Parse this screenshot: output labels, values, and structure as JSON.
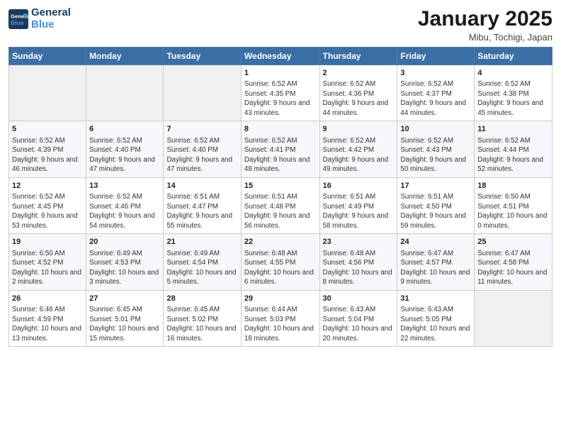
{
  "logo": {
    "line1": "General",
    "line2": "Blue"
  },
  "title": "January 2025",
  "subtitle": "Mibu, Tochigi, Japan",
  "days_of_week": [
    "Sunday",
    "Monday",
    "Tuesday",
    "Wednesday",
    "Thursday",
    "Friday",
    "Saturday"
  ],
  "weeks": [
    [
      {
        "day": "",
        "info": ""
      },
      {
        "day": "",
        "info": ""
      },
      {
        "day": "",
        "info": ""
      },
      {
        "day": "1",
        "info": "Sunrise: 6:52 AM\nSunset: 4:35 PM\nDaylight: 9 hours and 43 minutes."
      },
      {
        "day": "2",
        "info": "Sunrise: 6:52 AM\nSunset: 4:36 PM\nDaylight: 9 hours and 44 minutes."
      },
      {
        "day": "3",
        "info": "Sunrise: 6:52 AM\nSunset: 4:37 PM\nDaylight: 9 hours and 44 minutes."
      },
      {
        "day": "4",
        "info": "Sunrise: 6:52 AM\nSunset: 4:38 PM\nDaylight: 9 hours and 45 minutes."
      }
    ],
    [
      {
        "day": "5",
        "info": "Sunrise: 6:52 AM\nSunset: 4:39 PM\nDaylight: 9 hours and 46 minutes."
      },
      {
        "day": "6",
        "info": "Sunrise: 6:52 AM\nSunset: 4:40 PM\nDaylight: 9 hours and 47 minutes."
      },
      {
        "day": "7",
        "info": "Sunrise: 6:52 AM\nSunset: 4:40 PM\nDaylight: 9 hours and 47 minutes."
      },
      {
        "day": "8",
        "info": "Sunrise: 6:52 AM\nSunset: 4:41 PM\nDaylight: 9 hours and 48 minutes."
      },
      {
        "day": "9",
        "info": "Sunrise: 6:52 AM\nSunset: 4:42 PM\nDaylight: 9 hours and 49 minutes."
      },
      {
        "day": "10",
        "info": "Sunrise: 6:52 AM\nSunset: 4:43 PM\nDaylight: 9 hours and 50 minutes."
      },
      {
        "day": "11",
        "info": "Sunrise: 6:52 AM\nSunset: 4:44 PM\nDaylight: 9 hours and 52 minutes."
      }
    ],
    [
      {
        "day": "12",
        "info": "Sunrise: 6:52 AM\nSunset: 4:45 PM\nDaylight: 9 hours and 53 minutes."
      },
      {
        "day": "13",
        "info": "Sunrise: 6:52 AM\nSunset: 4:46 PM\nDaylight: 9 hours and 54 minutes."
      },
      {
        "day": "14",
        "info": "Sunrise: 6:51 AM\nSunset: 4:47 PM\nDaylight: 9 hours and 55 minutes."
      },
      {
        "day": "15",
        "info": "Sunrise: 6:51 AM\nSunset: 4:48 PM\nDaylight: 9 hours and 56 minutes."
      },
      {
        "day": "16",
        "info": "Sunrise: 6:51 AM\nSunset: 4:49 PM\nDaylight: 9 hours and 58 minutes."
      },
      {
        "day": "17",
        "info": "Sunrise: 6:51 AM\nSunset: 4:50 PM\nDaylight: 9 hours and 59 minutes."
      },
      {
        "day": "18",
        "info": "Sunrise: 6:50 AM\nSunset: 4:51 PM\nDaylight: 10 hours and 0 minutes."
      }
    ],
    [
      {
        "day": "19",
        "info": "Sunrise: 6:50 AM\nSunset: 4:52 PM\nDaylight: 10 hours and 2 minutes."
      },
      {
        "day": "20",
        "info": "Sunrise: 6:49 AM\nSunset: 4:53 PM\nDaylight: 10 hours and 3 minutes."
      },
      {
        "day": "21",
        "info": "Sunrise: 6:49 AM\nSunset: 4:54 PM\nDaylight: 10 hours and 5 minutes."
      },
      {
        "day": "22",
        "info": "Sunrise: 6:48 AM\nSunset: 4:55 PM\nDaylight: 10 hours and 6 minutes."
      },
      {
        "day": "23",
        "info": "Sunrise: 6:48 AM\nSunset: 4:56 PM\nDaylight: 10 hours and 8 minutes."
      },
      {
        "day": "24",
        "info": "Sunrise: 6:47 AM\nSunset: 4:57 PM\nDaylight: 10 hours and 9 minutes."
      },
      {
        "day": "25",
        "info": "Sunrise: 6:47 AM\nSunset: 4:58 PM\nDaylight: 10 hours and 11 minutes."
      }
    ],
    [
      {
        "day": "26",
        "info": "Sunrise: 6:46 AM\nSunset: 4:59 PM\nDaylight: 10 hours and 13 minutes."
      },
      {
        "day": "27",
        "info": "Sunrise: 6:45 AM\nSunset: 5:01 PM\nDaylight: 10 hours and 15 minutes."
      },
      {
        "day": "28",
        "info": "Sunrise: 6:45 AM\nSunset: 5:02 PM\nDaylight: 10 hours and 16 minutes."
      },
      {
        "day": "29",
        "info": "Sunrise: 6:44 AM\nSunset: 5:03 PM\nDaylight: 10 hours and 18 minutes."
      },
      {
        "day": "30",
        "info": "Sunrise: 6:43 AM\nSunset: 5:04 PM\nDaylight: 10 hours and 20 minutes."
      },
      {
        "day": "31",
        "info": "Sunrise: 6:43 AM\nSunset: 5:05 PM\nDaylight: 10 hours and 22 minutes."
      },
      {
        "day": "",
        "info": ""
      }
    ]
  ]
}
